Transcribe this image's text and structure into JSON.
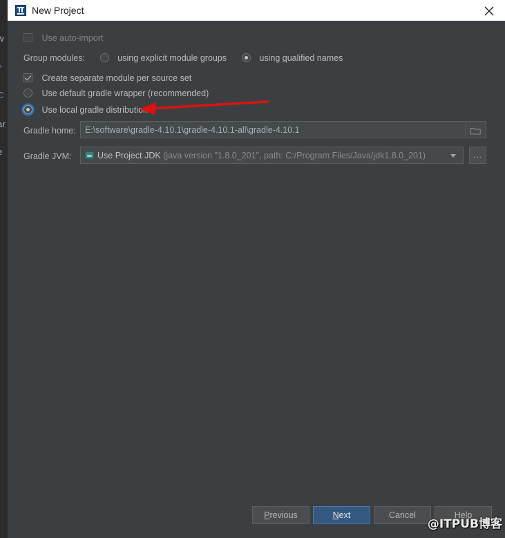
{
  "window": {
    "title": "New Project",
    "icon": "intellij-idea-icon",
    "close_label": "×",
    "background_color": "#3c3f41",
    "titlebar_color": "#ffffff"
  },
  "backdrop": {
    "fragments": [
      "w",
      "+",
      "C",
      "ar",
      "e"
    ]
  },
  "form": {
    "auto_import": {
      "label": "Use auto-import",
      "checked": false,
      "disabled": true
    },
    "group_modules": {
      "label": "Group modules:",
      "options": [
        {
          "label_before": "using explicit module ",
          "mnemonic": "g",
          "label_after": "roups",
          "selected": false
        },
        {
          "label_before": "using ",
          "mnemonic": "q",
          "label_after": "ualified names",
          "selected": true
        }
      ]
    },
    "separate_module": {
      "label": "Create separate module per source set",
      "checked": true
    },
    "gradle_distribution": {
      "options": [
        {
          "label": "Use default gradle wrapper (recommended)",
          "selected": false
        },
        {
          "label": "Use local gradle distribution",
          "selected": true
        }
      ]
    },
    "gradle_home": {
      "label": "Gradle home:",
      "value": "E:\\software\\gradle-4.10.1\\gradle-4.10.1-all\\gradle-4.10.1",
      "placeholder": "",
      "browse_icon": "folder-icon"
    },
    "gradle_jvm": {
      "label": "Gradle JVM:",
      "selected_primary": "Use Project JDK",
      "selected_secondary": "(java version \"1.8.0_201\", path: C:/Program Files/Java/jdk1.8.0_201)",
      "icon": "jdk-icon",
      "browse_label": "..."
    }
  },
  "footer": {
    "buttons": [
      {
        "label_before": "",
        "mnemonic": "P",
        "label_after": "revious",
        "primary": false
      },
      {
        "label_before": "",
        "mnemonic": "N",
        "label_after": "ext",
        "primary": true
      },
      {
        "label_before": "Cancel",
        "mnemonic": "",
        "label_after": "",
        "primary": false
      },
      {
        "label_before": "Help",
        "mnemonic": "",
        "label_after": "",
        "primary": false
      }
    ]
  },
  "annotation": {
    "arrow_color": "#e21010",
    "target": "Use local gradle distribution"
  },
  "watermark": {
    "text": "@ITPUB博客"
  }
}
